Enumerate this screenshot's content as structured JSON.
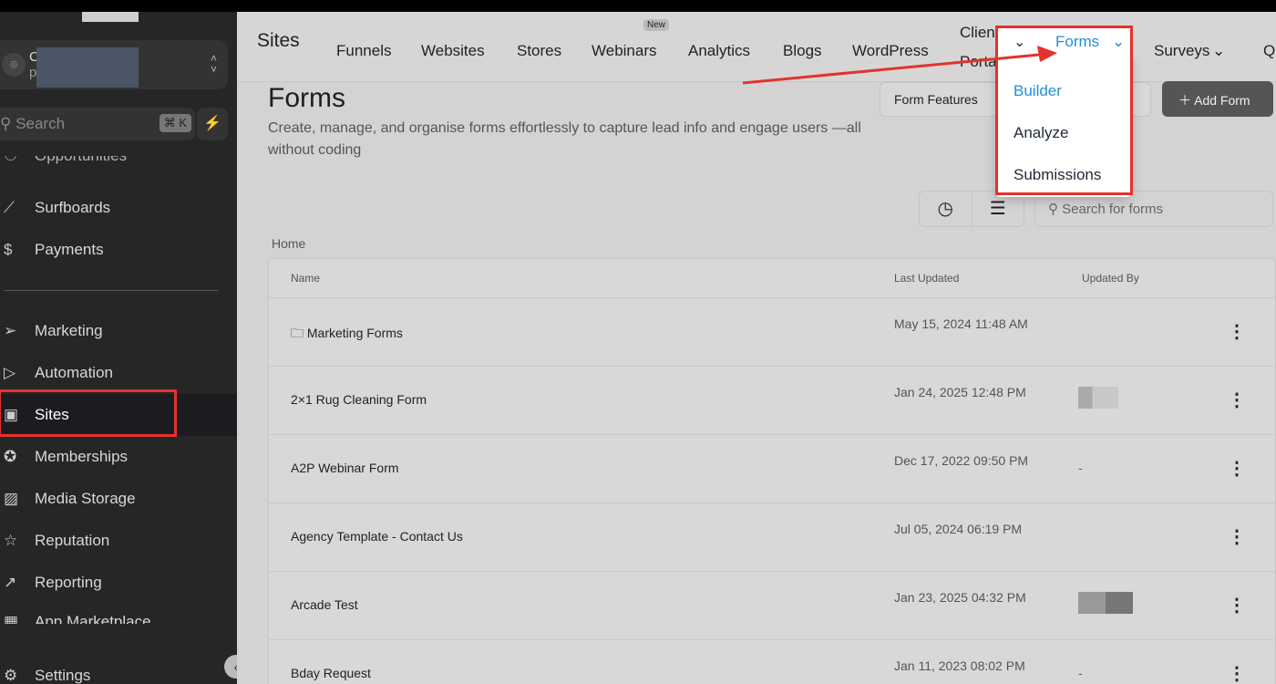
{
  "sidebar": {
    "account_initial": "C",
    "account_sub": "p",
    "search_placeholder": "Search",
    "search_shortcut": "⌘ K",
    "items": [
      {
        "label": "Opportunities",
        "icon": "handshake-icon"
      },
      {
        "label": "Surfboards",
        "icon": "surfboard-icon"
      },
      {
        "label": "Payments",
        "icon": "receipt-icon"
      },
      {
        "label": "Marketing",
        "icon": "send-icon"
      },
      {
        "label": "Automation",
        "icon": "play-icon"
      },
      {
        "label": "Sites",
        "icon": "globe-icon"
      },
      {
        "label": "Memberships",
        "icon": "award-icon"
      },
      {
        "label": "Media Storage",
        "icon": "image-icon"
      },
      {
        "label": "Reputation",
        "icon": "star-icon"
      },
      {
        "label": "Reporting",
        "icon": "trend-icon"
      },
      {
        "label": "App Marketplace",
        "icon": "grid-icon"
      },
      {
        "label": "Settings",
        "icon": "gear-icon"
      }
    ]
  },
  "header": {
    "brand": "Sites",
    "tabs": [
      "Funnels",
      "Websites",
      "Stores",
      "Webinars",
      "Analytics",
      "Blogs",
      "WordPress",
      "Client Portal",
      "Forms",
      "Surveys",
      "Q"
    ],
    "new_badge": "New"
  },
  "forms_menu": [
    "Builder",
    "Analyze",
    "Submissions"
  ],
  "page": {
    "title": "Forms",
    "description": "Create, manage, and organise forms effortlessly to capture lead info and engage users —all without coding",
    "form_features": "Form Features",
    "add_form": "Add Form",
    "search_placeholder": "Search for forms",
    "breadcrumb": "Home"
  },
  "table": {
    "headers": [
      "Name",
      "Last Updated",
      "Updated By"
    ],
    "rows": [
      {
        "name": "Marketing Forms",
        "updated": "May 15, 2024 11:48 AM",
        "by": ""
      },
      {
        "name": "2×1 Rug Cleaning Form",
        "updated": "Jan 24, 2025 12:48 PM",
        "by": ""
      },
      {
        "name": "A2P Webinar Form",
        "updated": "Dec 17, 2022 09:50 PM",
        "by": "-"
      },
      {
        "name": "Agency Template - Contact Us",
        "updated": "Jul 05, 2024 06:19 PM",
        "by": ""
      },
      {
        "name": "Arcade Test",
        "updated": "Jan 23, 2025 04:32 PM",
        "by": ""
      },
      {
        "name": "Bday Request",
        "updated": "Jan 11, 2023 08:02 PM",
        "by": "-"
      }
    ]
  },
  "colors": {
    "accent": "#1e90d8",
    "highlight": "#e5322d"
  }
}
